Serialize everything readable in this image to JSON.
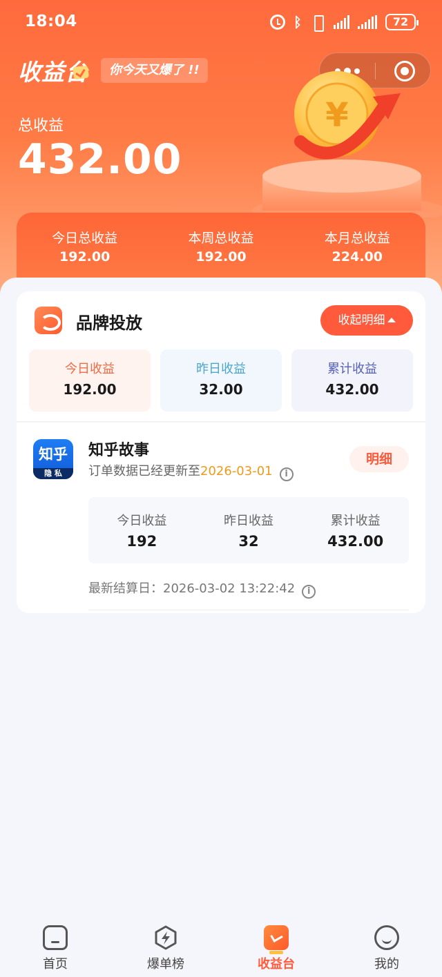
{
  "status_bar": {
    "time": "18:04",
    "battery": "72"
  },
  "header": {
    "title": "收益台",
    "slogan": "你今天又爆了 !!",
    "total_label": "总收益",
    "total_value": "432.00"
  },
  "summary": [
    {
      "label": "今日总收益",
      "value": "192.00"
    },
    {
      "label": "本周总收益",
      "value": "192.00"
    },
    {
      "label": "本月总收益",
      "value": "224.00"
    }
  ],
  "brand": {
    "title": "品牌投放",
    "collapse_label": "收起明细",
    "stats": [
      {
        "label": "今日收益",
        "value": "192.00"
      },
      {
        "label": "昨日收益",
        "value": "32.00"
      },
      {
        "label": "累计收益",
        "value": "432.00"
      }
    ]
  },
  "app": {
    "logo_text": "知乎",
    "logo_sub": "隐 私",
    "name": "知乎故事",
    "update_prefix": "订单数据已经更新至",
    "update_date": "2026-03-01",
    "detail_label": "明细",
    "stats": [
      {
        "label": "今日收益",
        "value": "192"
      },
      {
        "label": "昨日收益",
        "value": "32"
      },
      {
        "label": "累计收益",
        "value": "432.00"
      }
    ],
    "settle_label": "最新结算日：",
    "settle_time": "2026-03-02 13:22:42"
  },
  "tabs": [
    {
      "label": "首页",
      "icon": "home-icon",
      "active": false
    },
    {
      "label": "爆单榜",
      "icon": "lightning-hexagon-icon",
      "active": false
    },
    {
      "label": "收益台",
      "icon": "earnings-desk-icon",
      "active": true
    },
    {
      "label": "我的",
      "icon": "smiley-icon",
      "active": false
    }
  ],
  "colors": {
    "brand": "#ff5a3c",
    "accent_date": "#ef9a1a"
  }
}
